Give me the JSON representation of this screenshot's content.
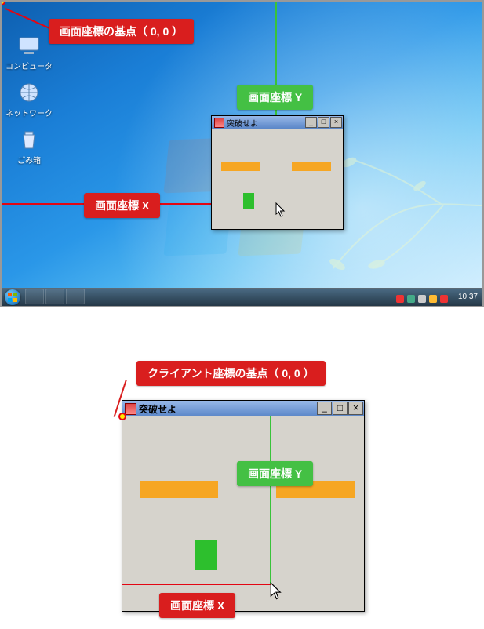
{
  "top": {
    "origin_label": "画面座標の基点（ 0, 0 ）",
    "x_label": "画面座標 X",
    "y_label": "画面座標 Y",
    "icons": {
      "computer": "コンピュータ",
      "network": "ネットワーク",
      "recycle": "ごみ箱"
    },
    "taskbar_time": "10:37",
    "app_title": "突破せよ"
  },
  "bottom": {
    "origin_label": "クライアント座標の基点（ 0, 0 ）",
    "x_label": "画面座標 X",
    "y_label": "画面座標 Y",
    "app_title": "突破せよ"
  },
  "colors": {
    "red": "#d91e1e",
    "green": "#44c044",
    "orange": "#f6a623",
    "player": "#2dbf2d"
  }
}
